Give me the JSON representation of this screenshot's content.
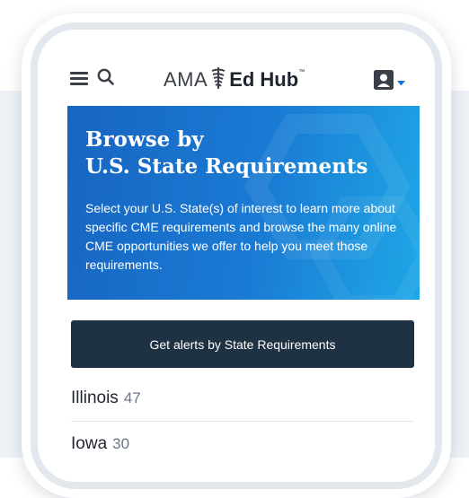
{
  "header": {
    "logo_ama": "AMA",
    "logo_edhub": "Ed Hub",
    "logo_tm": "™"
  },
  "hero": {
    "title_line1": "Browse by",
    "title_line2": "U.S. State Requirements",
    "description": "Select your U.S. State(s) of interest to learn more about specific CME requirements and browse the many online CME opportunities we offer to help you meet those requirements."
  },
  "alerts": {
    "button_label": "Get alerts by State Requirements"
  },
  "states": [
    {
      "name": "Illinois",
      "count": "47"
    },
    {
      "name": "Iowa",
      "count": "30"
    }
  ],
  "colors": {
    "hero_start": "#1765c2",
    "hero_end": "#1fa7e6",
    "button_bg": "#1f3244",
    "brand_text": "#3a3f47"
  },
  "icons": [
    "hamburger-menu-icon",
    "search-icon",
    "ama-staff-logo-icon",
    "user-profile-icon",
    "caret-down-icon"
  ]
}
